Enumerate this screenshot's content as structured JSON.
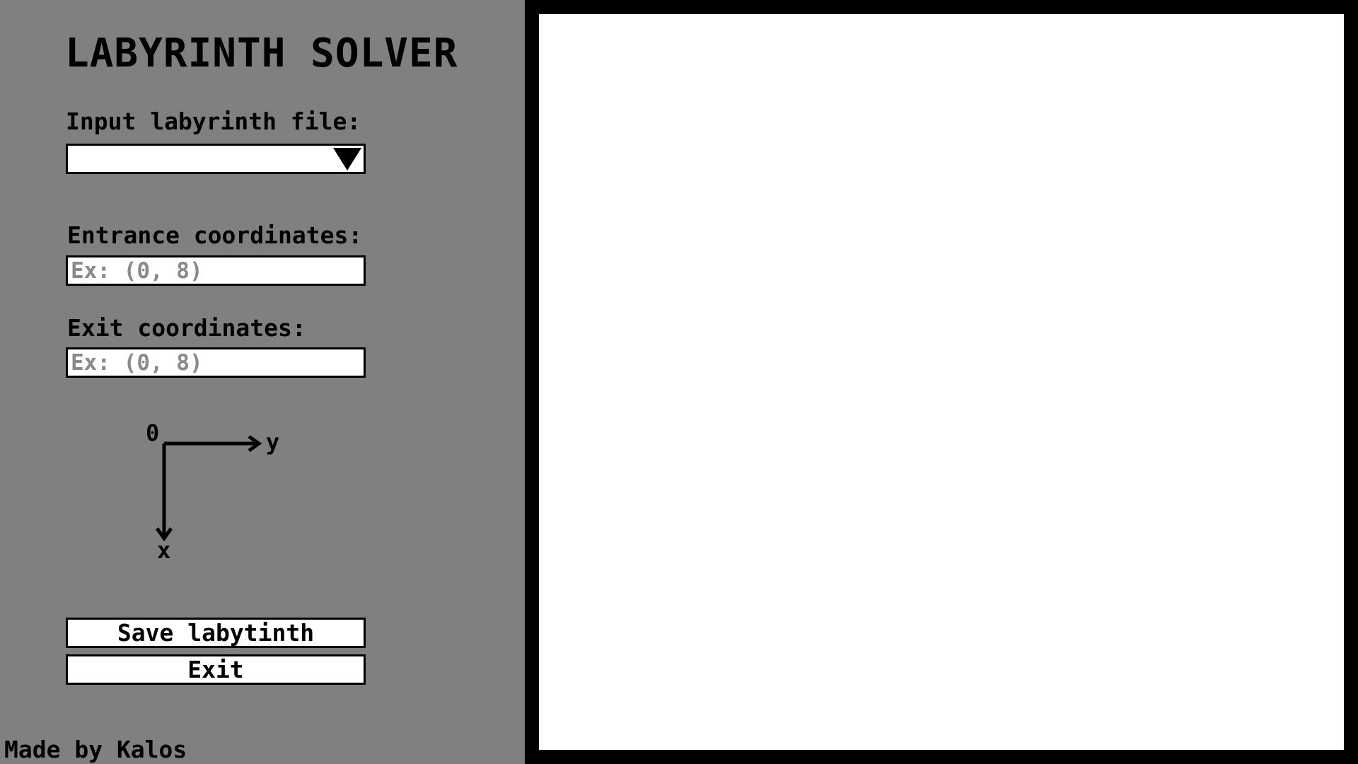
{
  "app": {
    "title": "LABYRINTH SOLVER"
  },
  "sidebar": {
    "file_label": "Input labyrinth file:",
    "file_dropdown": {
      "selected_value": "",
      "icon": "dropdown-triangle-icon"
    },
    "entrance_label": "Entrance coordinates:",
    "entrance_input": {
      "value": "",
      "placeholder": "Ex: (0, 8)"
    },
    "exit_label": "Exit coordinates:",
    "exit_input": {
      "value": "",
      "placeholder": "Ex: (0, 8)"
    },
    "axes_legend": {
      "origin": "0",
      "horizontal": "y",
      "vertical": "x"
    },
    "save_button": "Save labytinth",
    "exit_button": "Exit",
    "footer": "Made by Kalos"
  },
  "canvas": {
    "frame_color": "#000000",
    "background": "#ffffff"
  },
  "colors": {
    "sidebar_background": "#808080",
    "placeholder_text": "#8a8a8a"
  }
}
